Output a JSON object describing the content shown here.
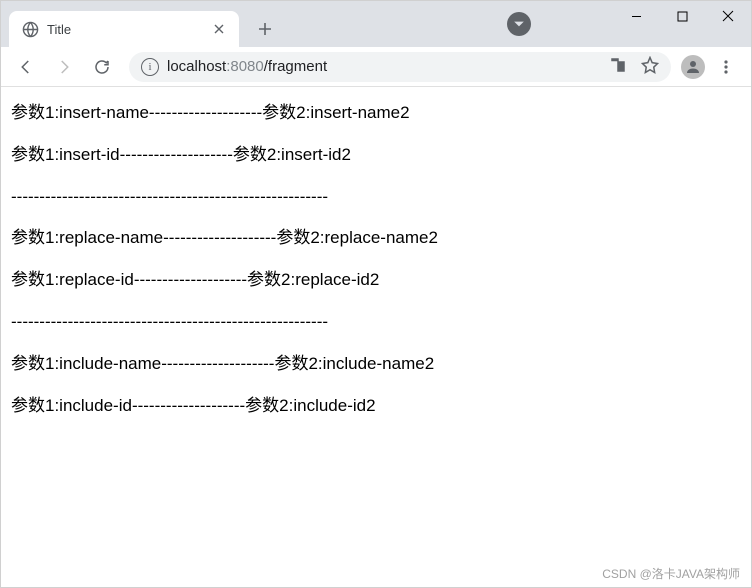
{
  "browser": {
    "tab": {
      "title": "Title"
    },
    "url": {
      "host": "localhost",
      "port": ":8080",
      "path": "/fragment"
    }
  },
  "page": {
    "lines": [
      "参数1:insert-name--------------------参数2:insert-name2",
      "参数1:insert-id--------------------参数2:insert-id2",
      "--------------------------------------------------------",
      "参数1:replace-name--------------------参数2:replace-name2",
      "参数1:replace-id--------------------参数2:replace-id2",
      "--------------------------------------------------------",
      "参数1:include-name--------------------参数2:include-name2",
      "参数1:include-id--------------------参数2:include-id2"
    ]
  },
  "watermark": "CSDN @洛卡JAVA架构师"
}
